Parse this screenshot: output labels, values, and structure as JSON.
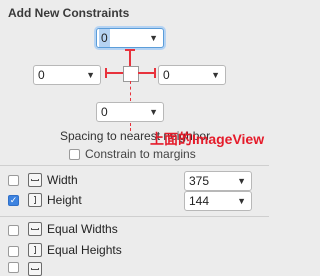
{
  "panel": {
    "title": "Add New Constraints"
  },
  "spacing": {
    "top_value": "0",
    "left_value": "0",
    "right_value": "0",
    "bottom_value": "0",
    "label": "Spacing to nearest neighbor",
    "annotation": "上面的ImageView",
    "accent_color": "#e8323c"
  },
  "constrain_margins": {
    "label": "Constrain to margins",
    "checked": false
  },
  "size": {
    "width_label": "Width",
    "width_checked": false,
    "width_value": "375",
    "height_label": "Height",
    "height_checked": true,
    "height_value": "144"
  },
  "equal": {
    "widths_label": "Equal Widths",
    "heights_label": "Equal Heights"
  },
  "icons": {
    "dropdown": "chevron-down-icon",
    "checkmark": "✓"
  }
}
